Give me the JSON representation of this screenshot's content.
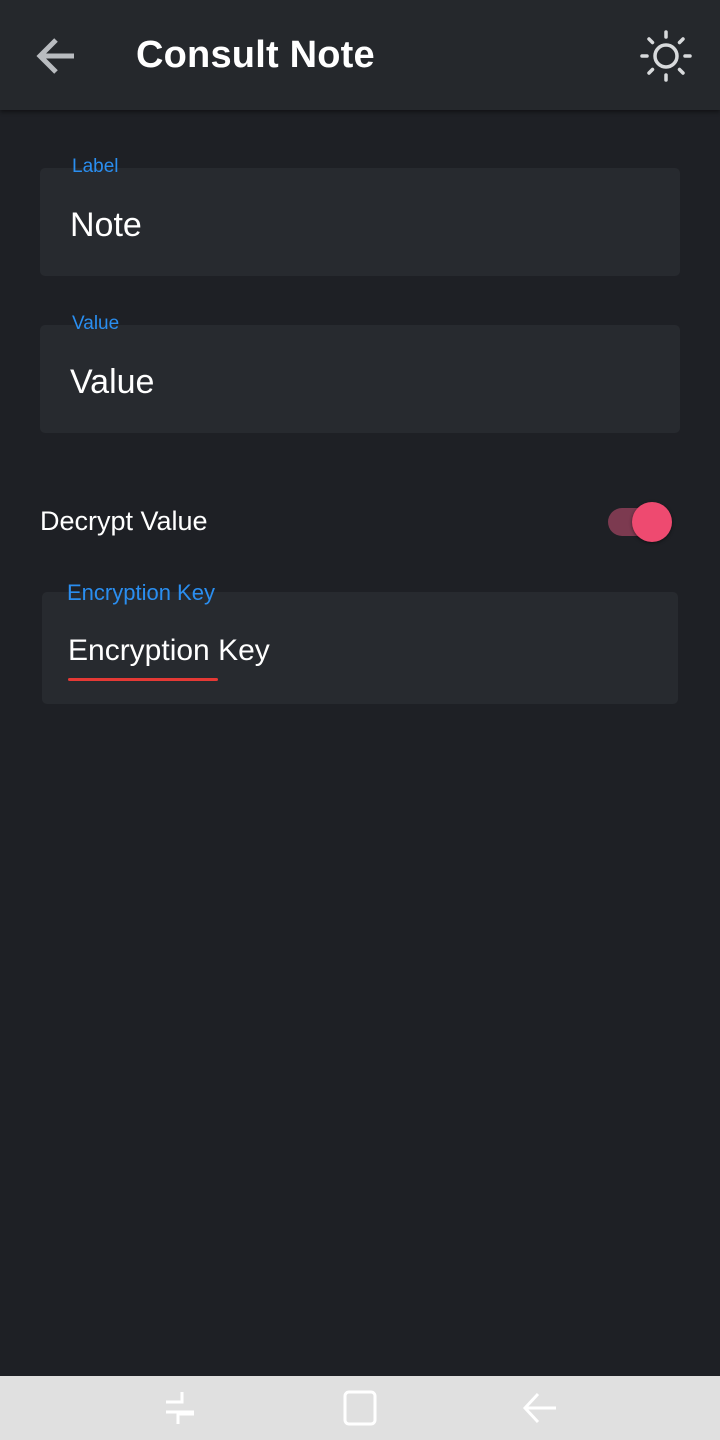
{
  "appbar": {
    "title": "Consult Note",
    "back_icon": "arrow-left-icon",
    "theme_icon": "sun-icon"
  },
  "fields": {
    "label": {
      "label": "Label",
      "value": "Note"
    },
    "value": {
      "label": "Value",
      "value": "Value"
    },
    "encryption_key": {
      "label": "Encryption Key",
      "placeholder": "Encryption Key",
      "word1": "Encryption",
      "word2": " Key"
    }
  },
  "decrypt": {
    "label": "Decrypt Value",
    "enabled": true
  },
  "colors": {
    "accent": "#2a8ef0",
    "switch_thumb": "#ee4a70",
    "switch_track": "#7c3a50",
    "background": "#1e2025",
    "appbar": "#25282c",
    "field": "#272a2f"
  },
  "navbar": {
    "icons": [
      "recent-apps-icon",
      "home-icon",
      "back-icon"
    ]
  }
}
